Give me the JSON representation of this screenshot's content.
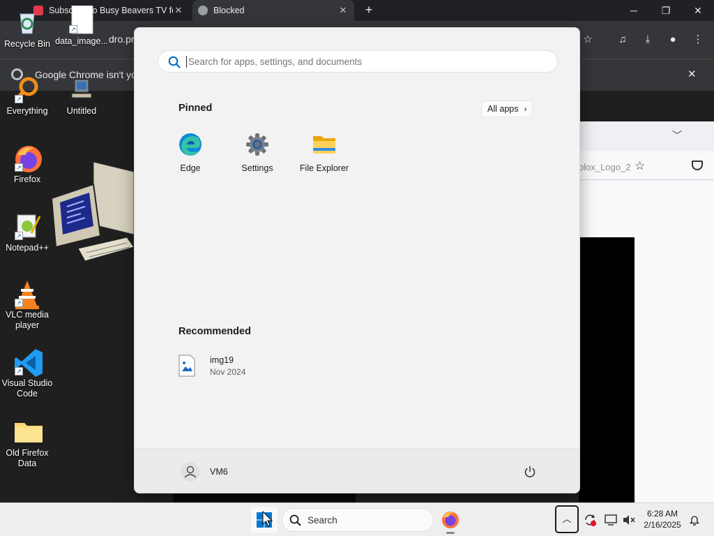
{
  "chrome": {
    "tabs": [
      {
        "title": "Subscribe to Busy Beavers TV fo"
      },
      {
        "title": "Blocked"
      }
    ],
    "new_tab": "+",
    "address_fragment": "dro.pr",
    "infobar_text": "Google Chrome isn't you"
  },
  "firefox_fragment": {
    "url_fragment": "blox_Logo_2"
  },
  "desktop": {
    "icons": [
      {
        "label": "Recycle Bin"
      },
      {
        "label": "data_image..."
      },
      {
        "label": "Everything"
      },
      {
        "label": "Untitled"
      },
      {
        "label": "Firefox"
      },
      {
        "label": "Notepad++"
      },
      {
        "label": "VLC media player"
      },
      {
        "label": "Visual Studio Code"
      },
      {
        "label": "Old Firefox Data"
      }
    ]
  },
  "start_menu": {
    "search_placeholder": "Search for apps, settings, and documents",
    "pinned_title": "Pinned",
    "all_apps_label": "All apps",
    "pinned_apps": [
      {
        "label": "Edge",
        "icon": "edge-icon"
      },
      {
        "label": "Settings",
        "icon": "settings-gear-icon"
      },
      {
        "label": "File Explorer",
        "icon": "folder-icon"
      }
    ],
    "recommended_title": "Recommended",
    "recommended": [
      {
        "name": "img19",
        "date": "Nov 2024"
      }
    ],
    "user_name": "VM6"
  },
  "taskbar": {
    "search_label": "Search",
    "time": "6:28 AM",
    "date": "2/16/2025"
  },
  "colors": {
    "accent": "#0067c0",
    "start_bg": "#f2f2f2",
    "taskbar_bg": "#eeeeee"
  }
}
